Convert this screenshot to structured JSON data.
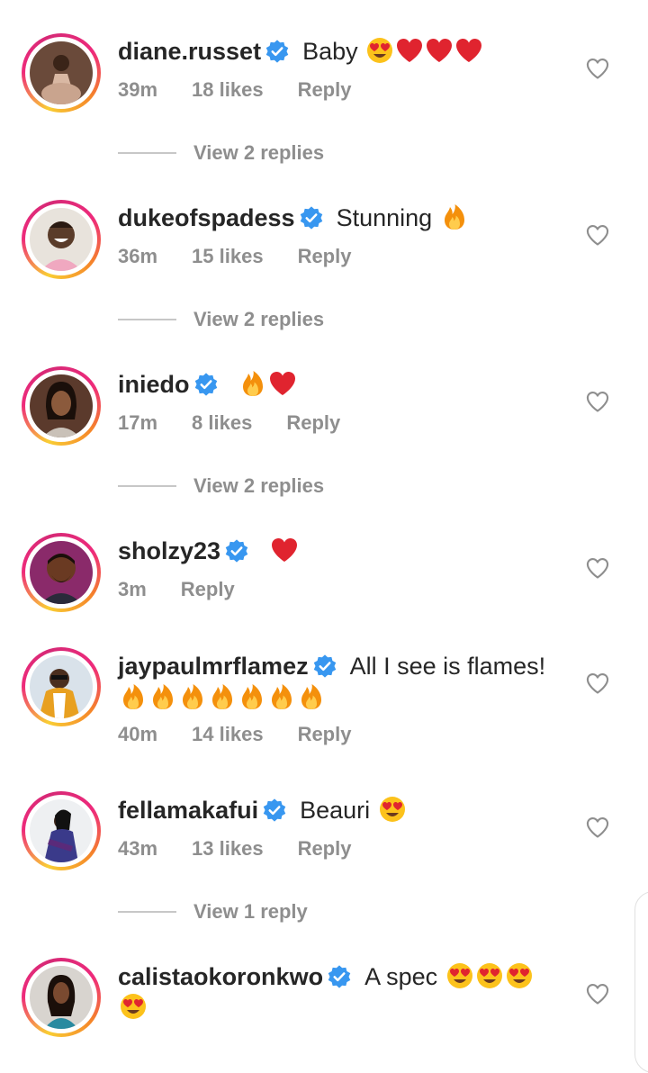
{
  "comments": [
    {
      "username": "diane.russet",
      "text": "Baby",
      "emojis": [
        "heart-eyes",
        "red-heart",
        "red-heart",
        "red-heart"
      ],
      "time": "39m",
      "likes": "18 likes",
      "reply_label": "Reply",
      "view_replies": "View 2 replies"
    },
    {
      "username": "dukeofspadess",
      "text": "Stunning",
      "emojis": [
        "fire"
      ],
      "time": "36m",
      "likes": "15 likes",
      "reply_label": "Reply",
      "view_replies": "View 2 replies"
    },
    {
      "username": "iniedo",
      "text": "",
      "emojis": [
        "fire",
        "red-heart"
      ],
      "time": "17m",
      "likes": "8 likes",
      "reply_label": "Reply",
      "view_replies": "View 2 replies"
    },
    {
      "username": "sholzy23",
      "text": "",
      "emojis": [
        "red-heart"
      ],
      "time": "3m",
      "reply_label": "Reply"
    },
    {
      "username": "jaypaulmrflamez",
      "text": "All I see is flames!",
      "emojis_line2": [
        "fire",
        "fire",
        "fire",
        "fire",
        "fire",
        "fire",
        "fire"
      ],
      "time": "40m",
      "likes": "14 likes",
      "reply_label": "Reply"
    },
    {
      "username": "fellamakafui",
      "text": "Beauri",
      "emojis": [
        "heart-eyes"
      ],
      "time": "43m",
      "likes": "13 likes",
      "reply_label": "Reply",
      "view_replies": "View 1 reply"
    },
    {
      "username": "calistaokoronkwo",
      "text": "A spec",
      "emojis": [
        "heart-eyes",
        "heart-eyes",
        "heart-eyes"
      ],
      "emojis_line2": [
        "heart-eyes"
      ]
    }
  ],
  "colors": {
    "verified": "#3897f0",
    "meta_text": "#8e8e8e",
    "primary_text": "#262626",
    "heart_emoji": "#e0242f"
  }
}
